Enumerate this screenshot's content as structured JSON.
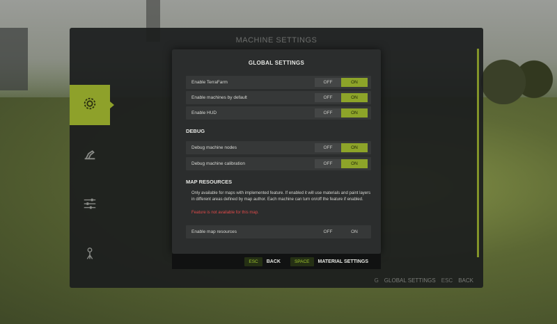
{
  "background_panel": {
    "title": "MACHINE SETTINGS",
    "footer": {
      "global_key": "G",
      "global_label": "GLOBAL SETTINGS",
      "esc_key": "ESC",
      "back_label": "BACK"
    },
    "tabs": [
      {
        "icon": "gear-icon",
        "active": true
      },
      {
        "icon": "machine-arm-icon",
        "active": false
      },
      {
        "icon": "sliders-icon",
        "active": false
      },
      {
        "icon": "surveyor-icon",
        "active": false
      }
    ]
  },
  "dialog": {
    "title": "GLOBAL SETTINGS",
    "global_rows": [
      {
        "label": "Enable TerraFarm",
        "off": "OFF",
        "on": "ON",
        "value": "on"
      },
      {
        "label": "Enable machines by default",
        "off": "OFF",
        "on": "ON",
        "value": "on"
      },
      {
        "label": "Enable HUD",
        "off": "OFF",
        "on": "ON",
        "value": "on"
      }
    ],
    "debug_heading": "DEBUG",
    "debug_rows": [
      {
        "label": "Debug machine nodes",
        "off": "OFF",
        "on": "ON",
        "value": "on"
      },
      {
        "label": "Debug machine calibration",
        "off": "OFF",
        "on": "ON",
        "value": "on"
      }
    ],
    "map_heading": "MAP RESOURCES",
    "map_description": "Only available for maps with implemented feature. If enabled it will use materials and paint layers in different areas defined by map author. Each machine can turn on/off the feature if enabled.",
    "map_warning": "Feature is not available for this map.",
    "map_row": {
      "label": "Enable map resources",
      "off": "OFF",
      "on": "ON",
      "value": "disabled"
    }
  },
  "footer": {
    "esc_key": "ESC",
    "back_label": "BACK",
    "space_key": "SPACE",
    "material_label": "MATERIAL SETTINGS"
  },
  "colors": {
    "accent": "#8da429",
    "panel": "#2b2d2d",
    "row": "#363838",
    "warning": "#e04a4a"
  }
}
